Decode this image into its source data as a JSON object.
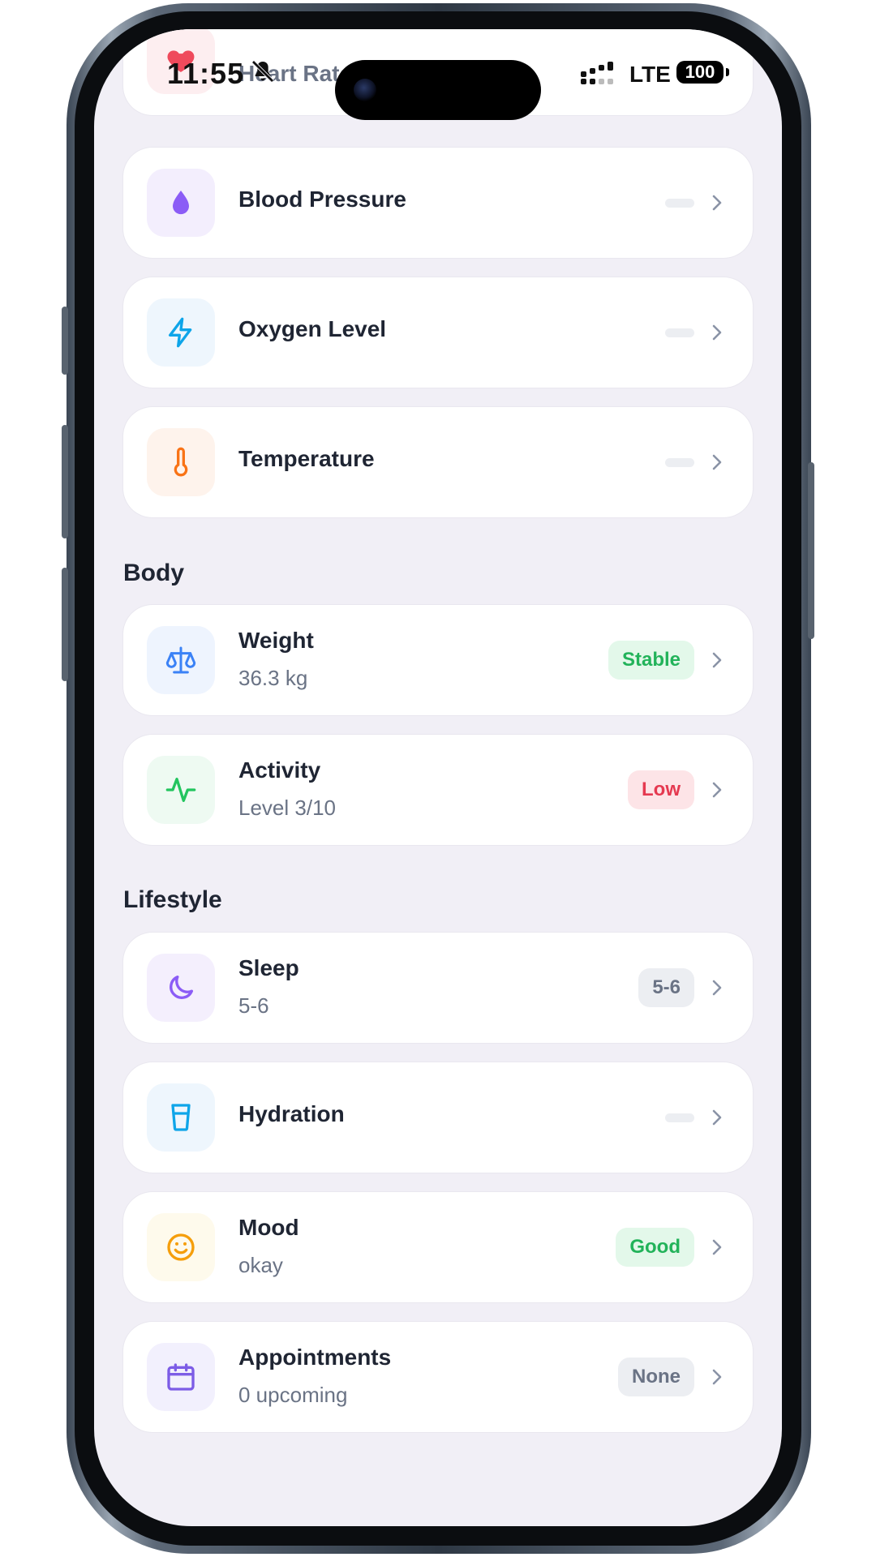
{
  "status_bar": {
    "time": "11:55",
    "network": "LTE",
    "battery": "100"
  },
  "cards_top": [
    {
      "title": "Heart Rate",
      "icon": "heart-icon",
      "icon_bg": "#fdeef0",
      "icon_color": "#ef4a5c"
    },
    {
      "title": "Blood Pressure",
      "icon": "droplet-icon",
      "icon_bg": "#f3eefd",
      "icon_color": "#8b5cf6"
    },
    {
      "title": "Oxygen Level",
      "icon": "lightning-icon",
      "icon_bg": "#eef6fd",
      "icon_color": "#0ea5e9"
    },
    {
      "title": "Temperature",
      "icon": "thermometer-icon",
      "icon_bg": "#fef3ec",
      "icon_color": "#f97316"
    }
  ],
  "sections": {
    "body": "Body",
    "lifestyle": "Lifestyle"
  },
  "body_cards": [
    {
      "title": "Weight",
      "subtitle": "36.3 kg",
      "badge": "Stable",
      "icon": "scale-icon",
      "icon_bg": "#eef4fe",
      "icon_color": "#3b82f6"
    },
    {
      "title": "Activity",
      "subtitle": "Level 3/10",
      "badge": "Low",
      "icon": "pulse-icon",
      "icon_bg": "#eefaf2",
      "icon_color": "#22c55e"
    }
  ],
  "lifestyle_cards": [
    {
      "title": "Sleep",
      "subtitle": "5-6",
      "badge": "5-6",
      "icon": "moon-icon",
      "icon_bg": "#f4effd",
      "icon_color": "#8b5cf6"
    },
    {
      "title": "Hydration",
      "icon": "glass-icon",
      "icon_bg": "#eef6fd",
      "icon_color": "#0ea5e9"
    },
    {
      "title": "Mood",
      "subtitle": "okay",
      "badge": "Good",
      "icon": "smiley-icon",
      "icon_bg": "#fefaec",
      "icon_color": "#f59e0b"
    },
    {
      "title": "Appointments",
      "subtitle": "0 upcoming",
      "badge": "None",
      "icon": "calendar-icon",
      "icon_bg": "#f2f0fd",
      "icon_color": "#7c5ce6"
    }
  ],
  "badge_colors": {
    "green": {
      "bg": "#e3f8ea",
      "fg": "#22b35a"
    },
    "red": {
      "bg": "#fde4e7",
      "fg": "#e53950"
    },
    "gray": {
      "bg": "#eceef2",
      "fg": "#6a7385"
    }
  }
}
